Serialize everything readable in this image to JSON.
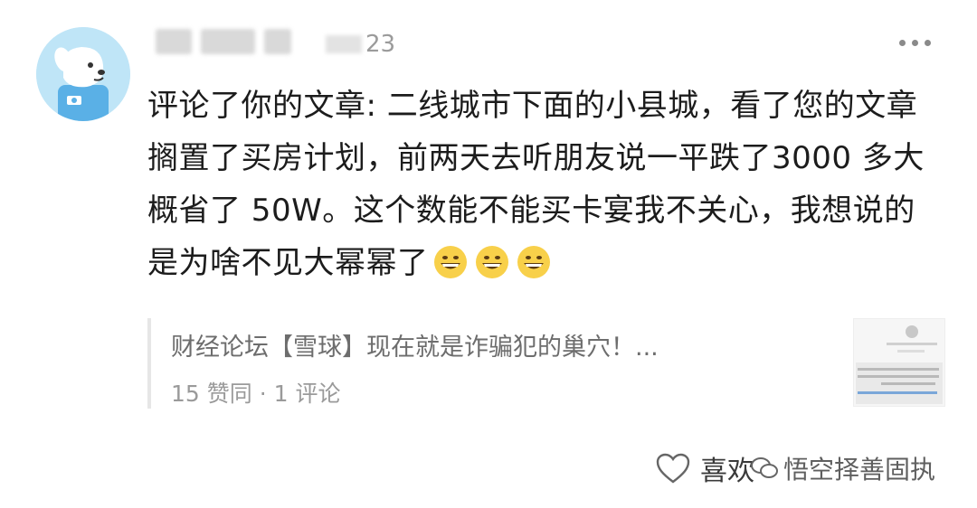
{
  "comment": {
    "timestamp": "23",
    "text": "评论了你的文章: 二线城市下面的小县城，看了您的文章搁置了买房计划，前两天去听朋友说一平跌了3000 多大概省了 50W。这个数能不能买卡宴我不关心，我想说的是为啥不见大幂幂了",
    "emoji_count": 3
  },
  "quote": {
    "title": "财经论坛【雪球】现在就是诈骗犯的巢穴！...",
    "meta": "15 赞同 · 1 评论"
  },
  "actions": {
    "like_label": "喜欢"
  },
  "watermark": {
    "text": "悟空择善固执"
  }
}
